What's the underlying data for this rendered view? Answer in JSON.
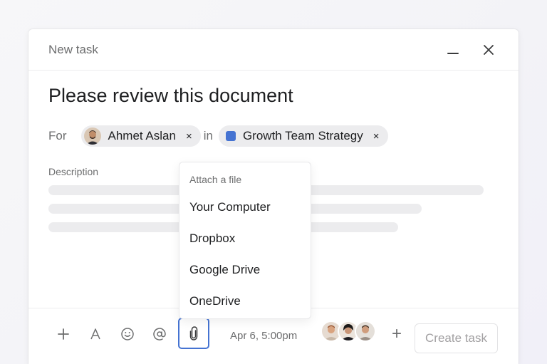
{
  "dialog": {
    "header_title": "New task",
    "task_title": "Please review this document",
    "for_label": "For",
    "in_label": "in",
    "assignee": {
      "name": "Ahmet Aslan",
      "remove": "×"
    },
    "project": {
      "name": "Growth Team Strategy",
      "remove": "×",
      "color": "#4573d2"
    },
    "description_label": "Description"
  },
  "footer": {
    "tools": [
      "plus-icon",
      "text-format-icon",
      "emoji-icon",
      "mention-icon",
      "paperclip-icon"
    ],
    "due_date": "Apr 6, 5:00pm",
    "add_collaborator": "+",
    "create_button": "Create task"
  },
  "attach_menu": {
    "header": "Attach a file",
    "items": [
      "Your Computer",
      "Dropbox",
      "Google Drive",
      "OneDrive"
    ]
  },
  "colors": {
    "accent": "#4573d2",
    "muted": "#6d6e6f",
    "pill": "#ececee"
  }
}
